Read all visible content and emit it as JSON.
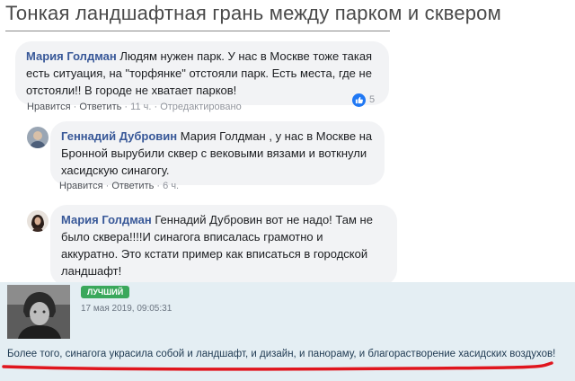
{
  "title": "Тонкая ландшафтная грань между парком и сквером",
  "comments": [
    {
      "author": "Мария Голдман",
      "lines": [
        "Людям нужен парк. У нас в Москве тоже такая",
        "есть ситуация, на \"торфянке\" отстояли парк. Есть места, где не",
        "отстояли!! В городе не хватает парков!"
      ],
      "reactions": "5",
      "like": "Нравится",
      "reply": "Ответить",
      "time": "11 ч.",
      "edited": "Отредактировано"
    },
    {
      "author": "Геннадий Дубровин",
      "lines": [
        "Мария Голдман , у нас в Москве на",
        "Бронной вырубили сквер с вековыми вязами и воткнули",
        "хасидскую синагогу."
      ],
      "like": "Нравится",
      "reply": "Ответить",
      "time": "6 ч."
    },
    {
      "author": "Мария Голдман",
      "lines": [
        "Геннадий Дубровин вот не надо! Там не",
        "было сквера!!!!И синагога вписалась грамотно и",
        "аккуратно. Это кстати пример как вписаться в городской",
        "ландшафт!"
      ]
    }
  ],
  "best": {
    "badge": "ЛУЧШИЙ",
    "date": "17 мая 2019, 09:05:31",
    "text": "Более того, синагога украсила собой и ландшафт, и дизайн, и панораму, и благорастворение хасидских воздухов!"
  },
  "colors": {
    "accent": "#385898",
    "best_bg": "#e4eef3",
    "badge_green": "#3aa85b",
    "underline_red": "#e0161e"
  }
}
